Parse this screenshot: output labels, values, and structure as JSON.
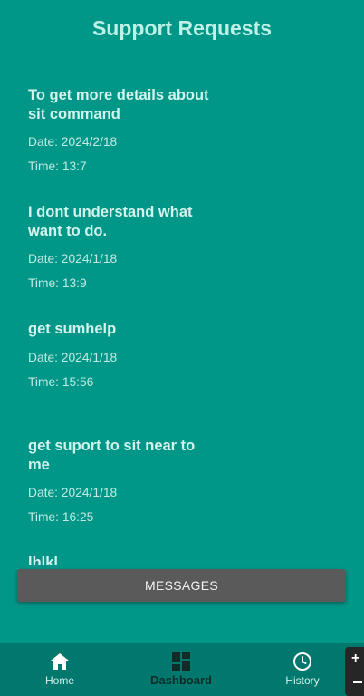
{
  "header": {
    "title": "Support Requests"
  },
  "requests": [
    {
      "title": "To get more details about sit command",
      "date": "Date: 2024/2/18",
      "time": "Time: 13:7"
    },
    {
      "title": "I dont understand what want to do.",
      "date": "Date: 2024/1/18",
      "time": "Time: 13:9"
    },
    {
      "title": "get sumhelp",
      "date": "Date: 2024/1/18",
      "time": "Time: 15:56"
    },
    {
      "title": "get suport to sit near to me",
      "date": "Date: 2024/1/18",
      "time": "Time: 16:25"
    },
    {
      "title": "lhlkl"
    }
  ],
  "messages_button": {
    "label": "MESSAGES"
  },
  "bottom_nav": {
    "items": [
      {
        "label": "Home",
        "icon": "home-icon"
      },
      {
        "label": "Dashboard",
        "icon": "dashboard-icon",
        "active": true
      },
      {
        "label": "History",
        "icon": "clock-icon"
      }
    ]
  },
  "colors": {
    "background": "#009688",
    "nav_background": "#00786d",
    "button_background": "#5a5a5a",
    "title_text": "#bff0e6"
  }
}
